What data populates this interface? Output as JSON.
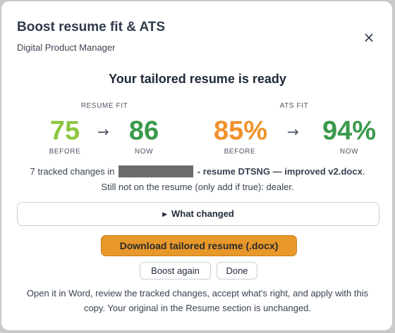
{
  "dialog": {
    "title": "Boost resume fit & ATS",
    "subtitle": "Digital Product Manager",
    "close_glyph": "×"
  },
  "result": {
    "heading": "Your tailored resume is ready",
    "resume_fit": {
      "label": "RESUME FIT",
      "before": "75",
      "now": "86",
      "before_label": "BEFORE",
      "now_label": "NOW",
      "before_color": "#8cc63f",
      "now_color": "#3a9a4a"
    },
    "ats_fit": {
      "label": "ATS FIT",
      "before": "85%",
      "now": "94%",
      "before_label": "BEFORE",
      "now_label": "NOW",
      "before_color": "#f0922b",
      "now_color": "#3a9a4a"
    },
    "arrow_glyph": "→",
    "changes_prefix": "7 tracked changes in",
    "filename": "- resume DTSNG — improved v2.docx",
    "changes_suffix": ".",
    "note": "Still not on the resume (only add if true): dealer."
  },
  "details": {
    "label": "What changed",
    "icon": "triangle-right-icon"
  },
  "actions": {
    "download_label": "Download tailored resume (.docx)",
    "boost_again_label": "Boost again",
    "done_label": "Done"
  },
  "footer": {
    "text": "Open it in Word, review the tracked changes, accept what's right, and apply with this copy. Your original in the Resume section is unchanged."
  },
  "colors": {
    "accent": "#e8982a"
  }
}
